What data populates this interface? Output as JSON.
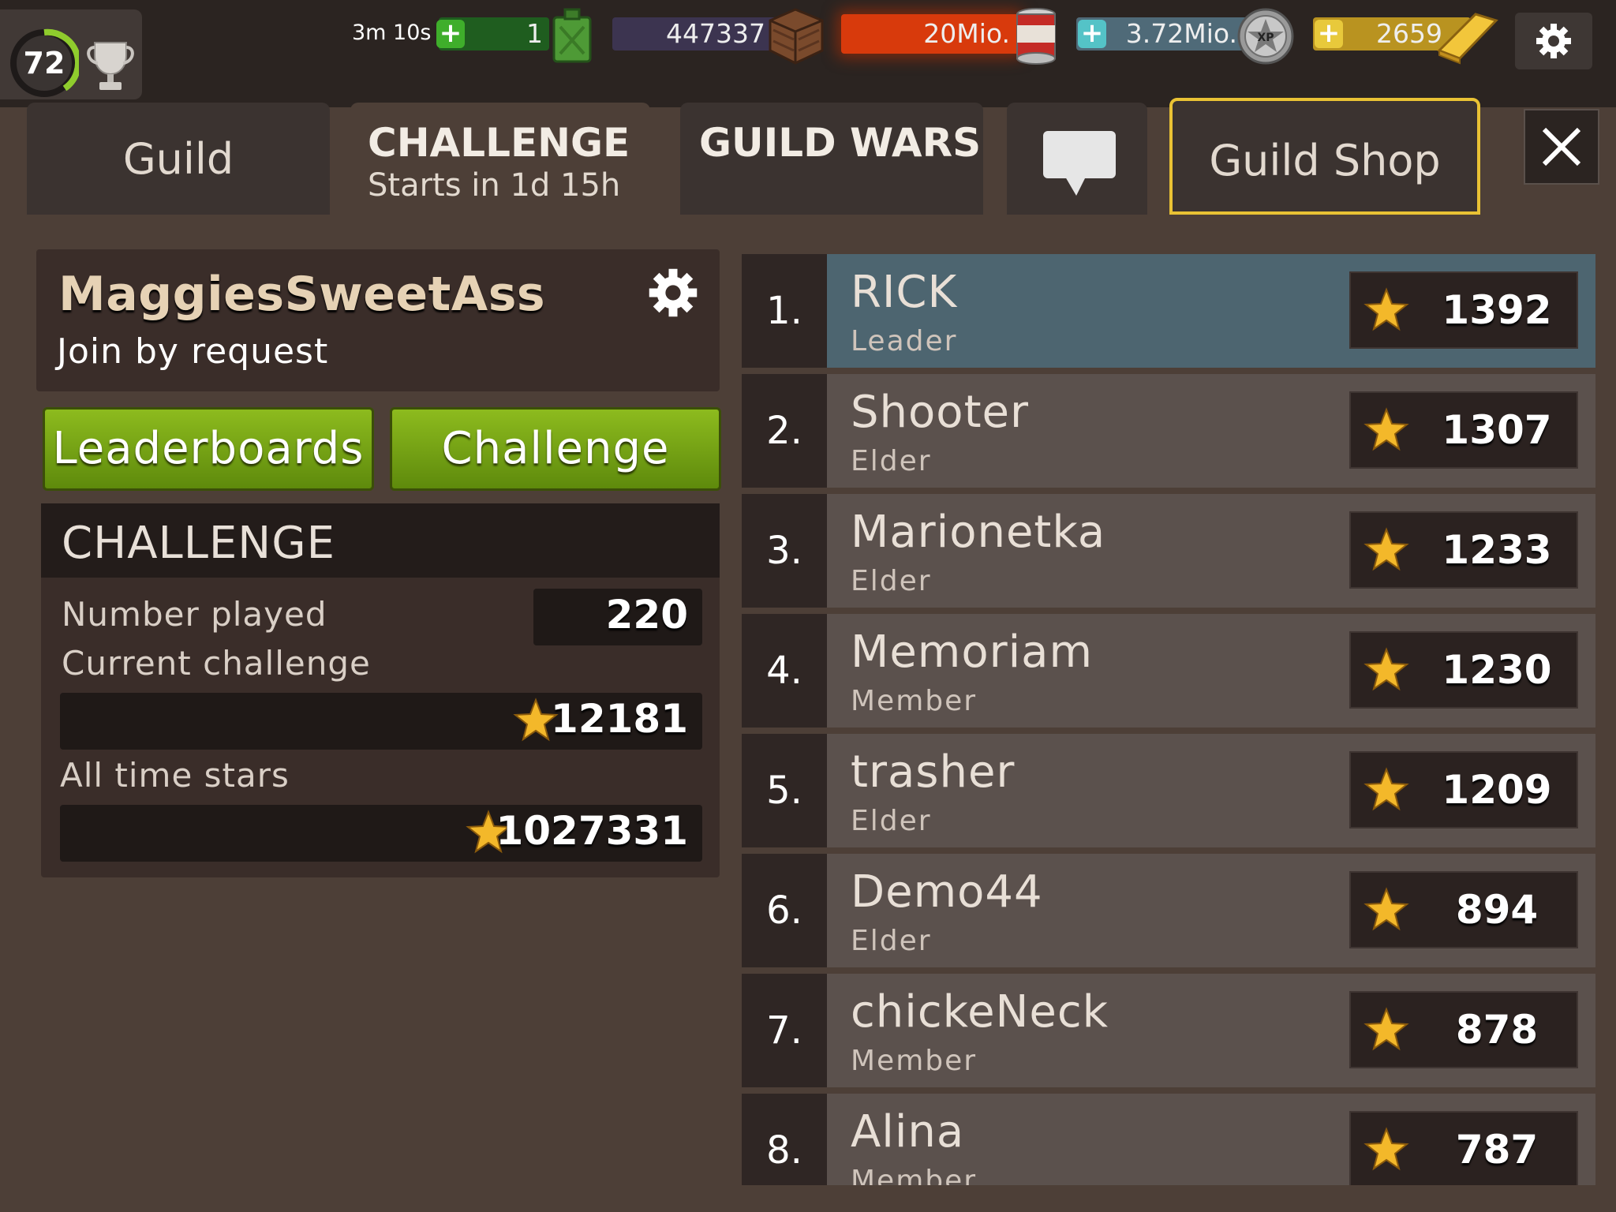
{
  "topbar": {
    "level": "72",
    "energy_timer": "3m 10s",
    "fuel": "1",
    "supplies": "447337",
    "food": "20Mio.",
    "xp": "3.72Mio.",
    "gold": "2659"
  },
  "tabs": {
    "guild": "Guild",
    "challenge_title": "CHALLENGE",
    "challenge_sub": "Starts in 1d 15h",
    "guild_wars": "GUILD WARS",
    "guild_shop": "Guild Shop"
  },
  "guild": {
    "name": "MaggiesSweetAss",
    "join": "Join by request"
  },
  "buttons": {
    "leaderboards": "Leaderboards",
    "challenge": "Challenge"
  },
  "stats": {
    "title": "CHALLENGE",
    "number_played_label": "Number played",
    "number_played": "220",
    "current_label": "Current challenge",
    "current": "12181",
    "alltime_label": "All time stars",
    "alltime": "1027331"
  },
  "leaderboard": [
    {
      "rank": "1.",
      "name": "RICK",
      "role": "Leader",
      "score": "1392"
    },
    {
      "rank": "2.",
      "name": "Shooter",
      "role": "Elder",
      "score": "1307"
    },
    {
      "rank": "3.",
      "name": "Marionetka",
      "role": "Elder",
      "score": "1233"
    },
    {
      "rank": "4.",
      "name": "Memoriam",
      "role": "Member",
      "score": "1230"
    },
    {
      "rank": "5.",
      "name": "trasher",
      "role": "Elder",
      "score": "1209"
    },
    {
      "rank": "6.",
      "name": "Demo44",
      "role": "Elder",
      "score": "894"
    },
    {
      "rank": "7.",
      "name": "chickeNeck",
      "role": "Member",
      "score": "878"
    },
    {
      "rank": "8.",
      "name": "Alina",
      "role": "Member",
      "score": "787"
    }
  ],
  "colors": {
    "background": "#4d3f37",
    "green_button": "#7aa817",
    "leader_row": "#4d6570",
    "shop_border": "#e9c234",
    "food_bar": "#d83a0c"
  },
  "icons": [
    "trophy-icon",
    "plus-icon",
    "fuel-can-icon",
    "supply-crate-icon",
    "food-can-icon",
    "xp-badge-icon",
    "gold-bar-icon",
    "gear-icon",
    "chat-bubble-icon",
    "close-icon",
    "star-icon"
  ]
}
